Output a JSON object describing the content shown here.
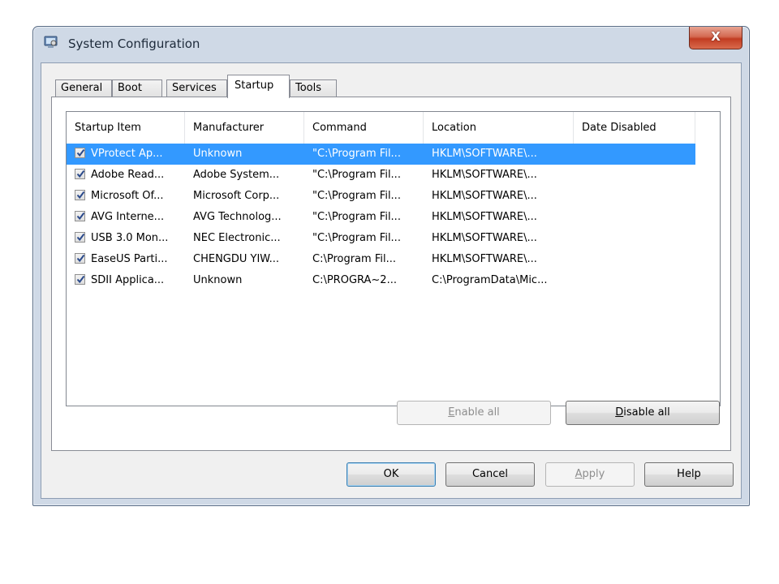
{
  "window": {
    "title": "System Configuration",
    "close_label": "X"
  },
  "tabs": [
    {
      "label": "General"
    },
    {
      "label": "Boot"
    },
    {
      "label": "Services"
    },
    {
      "label": "Startup"
    },
    {
      "label": "Tools"
    }
  ],
  "active_tab": "Startup",
  "list": {
    "columns": [
      "Startup Item",
      "Manufacturer",
      "Command",
      "Location",
      "Date Disabled"
    ],
    "rows": [
      {
        "item": "VProtect Ap...",
        "manufacturer": "Unknown",
        "command": "\"C:\\Program Fil...",
        "location": "HKLM\\SOFTWARE\\...",
        "date_disabled": "",
        "checked": true,
        "selected": true
      },
      {
        "item": "Adobe Read...",
        "manufacturer": "Adobe System...",
        "command": "\"C:\\Program Fil...",
        "location": "HKLM\\SOFTWARE\\...",
        "date_disabled": "",
        "checked": true,
        "selected": false
      },
      {
        "item": "Microsoft Of...",
        "manufacturer": "Microsoft Corp...",
        "command": "\"C:\\Program Fil...",
        "location": "HKLM\\SOFTWARE\\...",
        "date_disabled": "",
        "checked": true,
        "selected": false
      },
      {
        "item": "AVG Interne...",
        "manufacturer": "AVG Technolog...",
        "command": "\"C:\\Program Fil...",
        "location": "HKLM\\SOFTWARE\\...",
        "date_disabled": "",
        "checked": true,
        "selected": false
      },
      {
        "item": "USB 3.0 Mon...",
        "manufacturer": "NEC Electronic...",
        "command": "\"C:\\Program Fil...",
        "location": "HKLM\\SOFTWARE\\...",
        "date_disabled": "",
        "checked": true,
        "selected": false
      },
      {
        "item": "EaseUS Parti...",
        "manufacturer": "CHENGDU YIW...",
        "command": "C:\\Program Fil...",
        "location": "HKLM\\SOFTWARE\\...",
        "date_disabled": "",
        "checked": true,
        "selected": false
      },
      {
        "item": "SDII Applica...",
        "manufacturer": "Unknown",
        "command": "C:\\PROGRA~2...",
        "location": "C:\\ProgramData\\Mic...",
        "date_disabled": "",
        "checked": true,
        "selected": false
      }
    ]
  },
  "buttons": {
    "enable_all": {
      "label": "Enable all",
      "mnemonic": "E",
      "rest": "nable all"
    },
    "disable_all": {
      "label": "Disable all",
      "mnemonic": "D",
      "rest": "isable all"
    },
    "ok": "OK",
    "cancel": "Cancel",
    "apply": {
      "label": "Apply",
      "mnemonic": "A",
      "rest": "pply"
    },
    "help": "Help"
  },
  "colors": {
    "selection": "#3399ff",
    "close_button": "#c94a2f",
    "frame": "#cfd9e6"
  },
  "icons": {
    "app": "system-configuration-icon",
    "check": "checkmark-icon"
  }
}
